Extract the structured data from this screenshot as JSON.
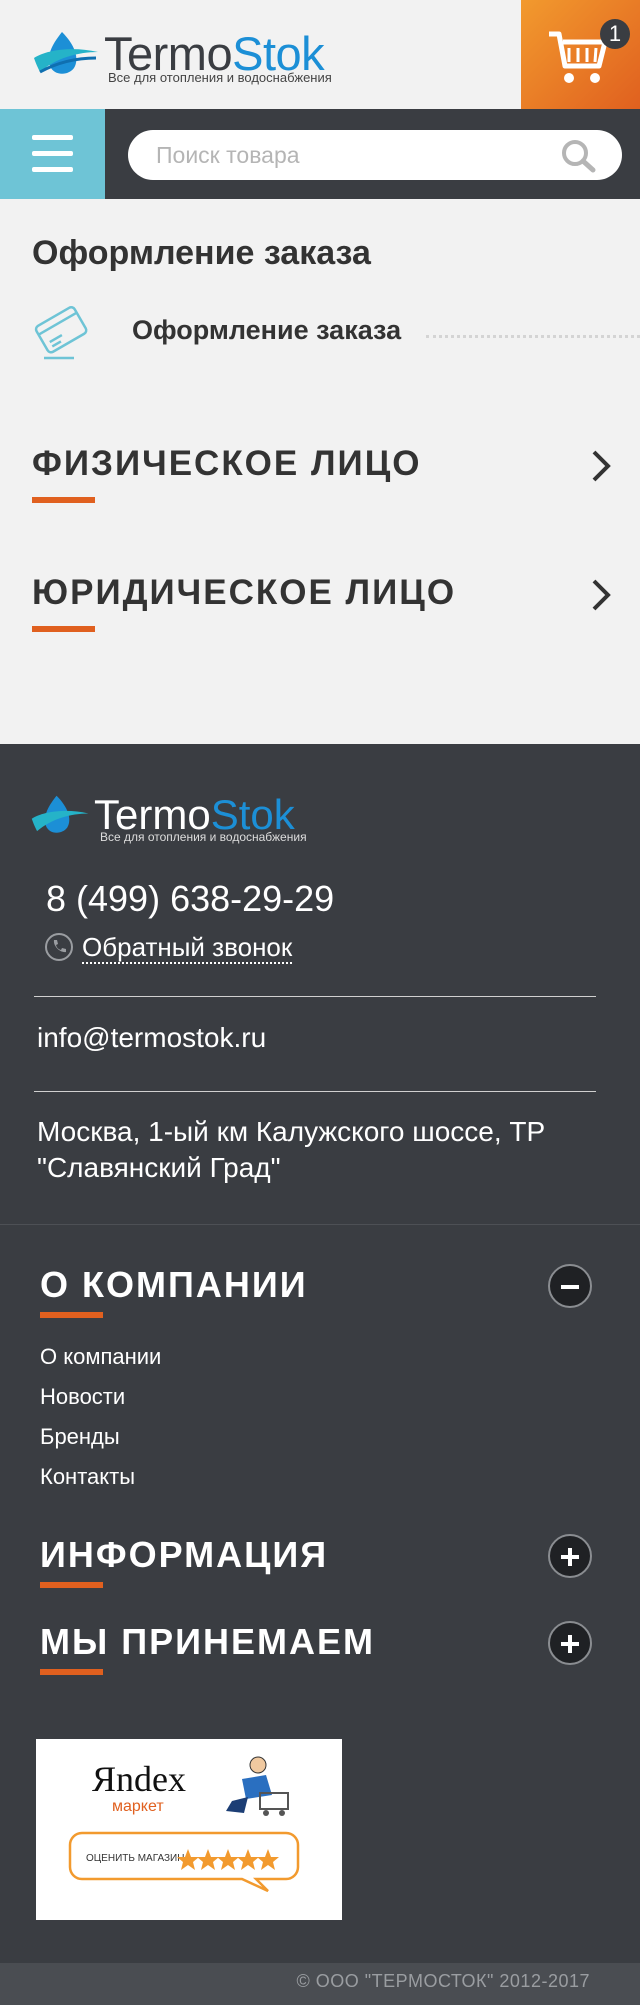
{
  "header": {
    "logo_part1": "Termo",
    "logo_part2": "Stok",
    "logo_tagline": "Все для отопления и водоснабжения",
    "cart_count": "1",
    "cart_icon": "cart-icon"
  },
  "navbar": {
    "menu_icon": "hamburger-icon",
    "search_placeholder": "Поиск товара",
    "search_icon": "search-icon"
  },
  "main": {
    "page_title": "Оформление заказа",
    "step_label": "Оформление заказа",
    "step_icon": "credit-card-icon",
    "options": [
      {
        "label": "ФИЗИЧЕСКОЕ ЛИЦО"
      },
      {
        "label": "ЮРИДИЧЕСКОЕ ЛИЦО"
      }
    ]
  },
  "footer": {
    "logo_part1": "Termo",
    "logo_part2": "Stok",
    "logo_tagline": "Все для отопления и водоснабжения",
    "phone": "8 (499) 638-29-29",
    "callback_label": "Обратный звонок",
    "callback_icon": "phone-icon",
    "email": "info@termostok.ru",
    "address": "Москва, 1-ый км Калужского шоссе, ТР \"Славянский Град\"",
    "sections": [
      {
        "title": "О КОМПАНИИ",
        "expanded": true,
        "items": [
          "О компании",
          "Новости",
          "Бренды",
          "Контакты"
        ]
      },
      {
        "title": "ИНФОРМАЦИЯ",
        "expanded": false
      },
      {
        "title": "МЫ ПРИНЕМАЕМ",
        "expanded": false
      }
    ],
    "yandex": {
      "logo_text": "Яndex",
      "sub_text": "маркет",
      "rate_text": "ОЦЕНИТЬ МАГАЗИН",
      "stars": 5
    },
    "copyright": "© ООО \"ТЕРМОСТОК\" 2012-2017"
  },
  "colors": {
    "accent_orange": "#e0601f",
    "brand_blue": "#1c8fd6",
    "menu_teal": "#6ec4d6",
    "footer_bg": "#3a3d42"
  }
}
